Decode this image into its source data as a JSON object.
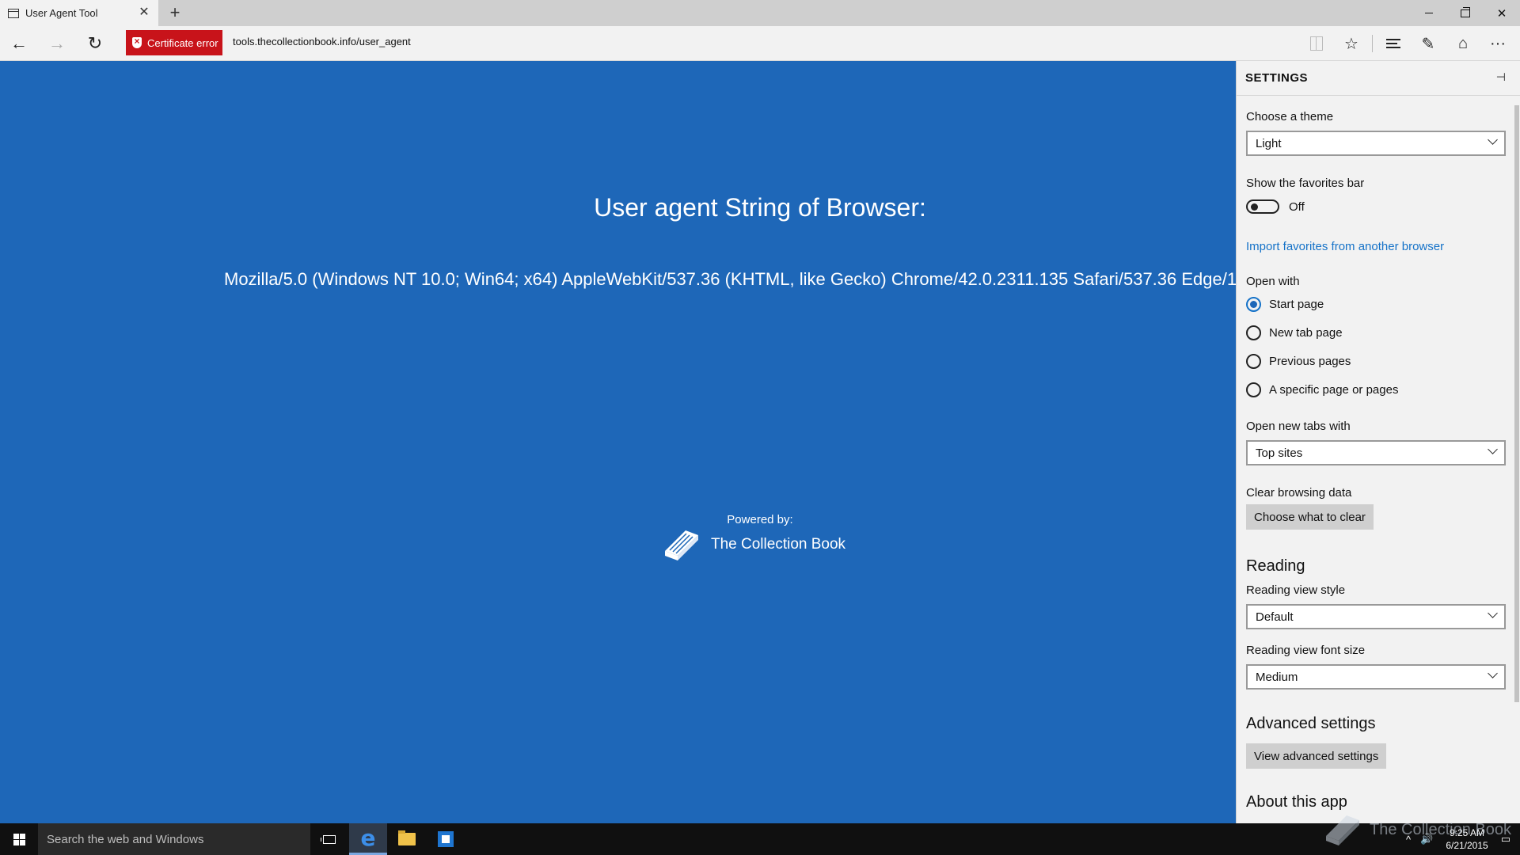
{
  "window": {
    "tab_title": "User Agent Tool",
    "tab_close": "✕",
    "new_tab": "+",
    "minimize": "",
    "restore": "",
    "close": "✕"
  },
  "address_bar": {
    "back": "←",
    "forward": "→",
    "refresh": "↻",
    "certificate_error": "Certificate error",
    "url": "tools.thecollectionbook.info/user_agent",
    "favorite_icon": "☆",
    "web_note_icon": "✎",
    "share_icon": "⌂",
    "more_icon": "···"
  },
  "page": {
    "title": "User agent String of Browser:",
    "user_agent": "Mozilla/5.0 (Windows NT 10.0; Win64; x64) AppleWebKit/537.36 (KHTML, like Gecko) Chrome/42.0.2311.135 Safari/537.36 Edge/1",
    "powered_by": "Powered by:",
    "brand_name": "The Collection Book"
  },
  "settings": {
    "header": "SETTINGS",
    "pin_icon": "⊣",
    "theme_label": "Choose a theme",
    "theme_value": "Light",
    "favorites_bar_label": "Show the favorites bar",
    "favorites_bar_state": "Off",
    "favorites_bar_on": false,
    "import_link": "Import favorites from another browser",
    "open_with_label": "Open with",
    "open_with_options": [
      "Start page",
      "New tab page",
      "Previous pages",
      "A specific page or pages"
    ],
    "open_with_selected": "Start page",
    "new_tabs_label": "Open new tabs with",
    "new_tabs_value": "Top sites",
    "clear_label": "Clear browsing data",
    "clear_button": "Choose what to clear",
    "reading_heading": "Reading",
    "reading_style_label": "Reading view style",
    "reading_style_value": "Default",
    "reading_font_label": "Reading view font size",
    "reading_font_value": "Medium",
    "advanced_heading": "Advanced settings",
    "advanced_button": "View advanced settings",
    "about_heading": "About this app"
  },
  "taskbar": {
    "search_placeholder": "Search the web and Windows",
    "tray_chevron": "^",
    "volume_icon": "🔊",
    "notifications_icon": "▭",
    "time": "9:25 AM",
    "date": "6/21/2015"
  },
  "watermark": {
    "text": "The Collection Book"
  },
  "colors": {
    "page_background": "#1e67b8",
    "certificate_error": "#c8131a",
    "link": "#1572c8",
    "settings_background": "#f2f2f2"
  }
}
